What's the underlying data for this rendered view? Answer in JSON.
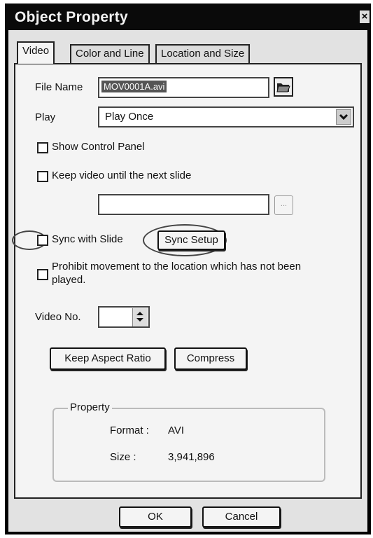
{
  "window": {
    "title": "Object Property",
    "close_glyph": "×"
  },
  "tabs": [
    {
      "label": "Video",
      "active": true
    },
    {
      "label": "Color and Line",
      "active": false
    },
    {
      "label": "Location and Size",
      "active": false
    }
  ],
  "file": {
    "label": "File Name",
    "value": "MOV0001A.avi",
    "browse_icon": "folder-open-icon"
  },
  "play": {
    "label": "Play",
    "value": "Play Once"
  },
  "options": {
    "show_control_panel": "Show Control Panel",
    "keep_video": "Keep video until the next slide",
    "sync_with_slide": "Sync with Slide",
    "prohibit_line1": "Prohibit movement to the location which has not been",
    "prohibit_line2": "played."
  },
  "buttons": {
    "sync_setup": "Sync Setup",
    "ellipsis": "...",
    "keep_aspect": "Keep Aspect Ratio",
    "compress": "Compress",
    "ok": "OK",
    "cancel": "Cancel"
  },
  "video_no": {
    "label": "Video No.",
    "value": ""
  },
  "property": {
    "title": "Property",
    "format_label": "Format :",
    "format_value": "AVI",
    "size_label": "Size :",
    "size_value": "3,941,896"
  }
}
